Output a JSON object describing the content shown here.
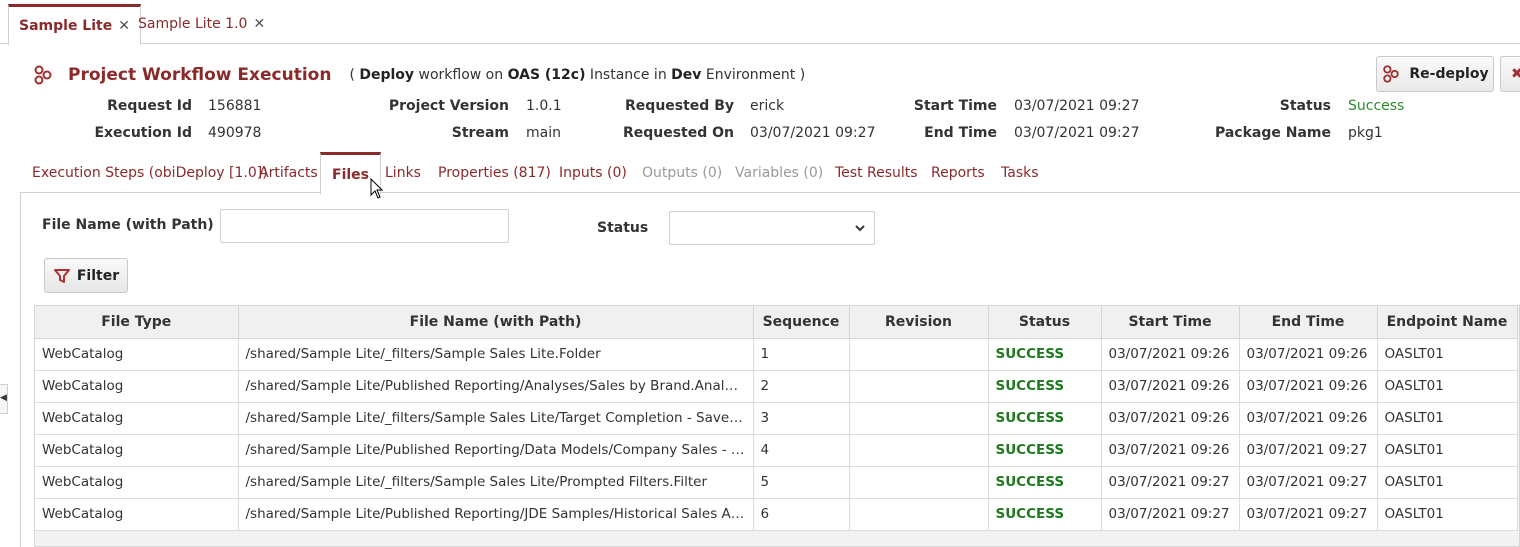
{
  "doc_tabs": [
    {
      "label": "Sample Lite",
      "active": true
    },
    {
      "label": "Sample Lite 1.0",
      "active": false
    }
  ],
  "close_glyph": "✕",
  "header": {
    "title": "Project Workflow Execution",
    "desc_open": "( ",
    "desc_workflow": "Deploy",
    "desc_on": " workflow on ",
    "desc_instance": "OAS (12c)",
    "desc_instance_in": " Instance in ",
    "desc_env": "Dev",
    "desc_close": " Environment )",
    "redeploy_label": "Re-deploy"
  },
  "meta": {
    "request_id_label": "Request Id",
    "request_id": "156881",
    "execution_id_label": "Execution Id",
    "execution_id": "490978",
    "project_version_label": "Project Version",
    "project_version": "1.0.1",
    "stream_label": "Stream",
    "stream": "main",
    "requested_by_label": "Requested By",
    "requested_by": "erick",
    "requested_on_label": "Requested On",
    "requested_on": "03/07/2021 09:27",
    "start_time_label": "Start Time",
    "start_time": "03/07/2021 09:27",
    "end_time_label": "End Time",
    "end_time": "03/07/2021 09:27",
    "status_label": "Status",
    "status": "Success",
    "package_name_label": "Package Name",
    "package_name": "pkg1"
  },
  "section_tabs": [
    {
      "label": "Execution Steps (obiDeploy [1.0])",
      "state": "normal"
    },
    {
      "label": "Artifacts",
      "state": "normal"
    },
    {
      "label": "Files",
      "state": "active"
    },
    {
      "label": "Links",
      "state": "normal"
    },
    {
      "label": "Properties (817)",
      "state": "normal"
    },
    {
      "label": "Inputs (0)",
      "state": "normal"
    },
    {
      "label": "Outputs (0)",
      "state": "disabled"
    },
    {
      "label": "Variables (0)",
      "state": "disabled"
    },
    {
      "label": "Test Results",
      "state": "normal"
    },
    {
      "label": "Reports",
      "state": "normal"
    },
    {
      "label": "Tasks",
      "state": "normal"
    }
  ],
  "filters": {
    "file_name_label": "File Name (with Path)",
    "file_name_value": "",
    "status_label": "Status",
    "status_value": "",
    "filter_button": "Filter"
  },
  "table": {
    "columns": [
      "File Type",
      "File Name (with Path)",
      "Sequence",
      "Revision",
      "Status",
      "Start Time",
      "End Time",
      "Endpoint Name"
    ],
    "rows": [
      [
        "WebCatalog",
        "/shared/Sample Lite/_filters/Sample Sales Lite.Folder",
        "1",
        "",
        "SUCCESS",
        "03/07/2021 09:26",
        "03/07/2021 09:26",
        "OASLT01"
      ],
      [
        "WebCatalog",
        "/shared/Sample Lite/Published Reporting/Analyses/Sales by Brand.Analysis",
        "2",
        "",
        "SUCCESS",
        "03/07/2021 09:26",
        "03/07/2021 09:26",
        "OASLT01"
      ],
      [
        "WebCatalog",
        "/shared/Sample Lite/_filters/Sample Sales Lite/Target Completion - Saved Column.Filter",
        "3",
        "",
        "SUCCESS",
        "03/07/2021 09:26",
        "03/07/2021 09:26",
        "OASLT01"
      ],
      [
        "WebCatalog",
        "/shared/Sample Lite/Published Reporting/Data Models/Company Sales - Currency.DataModel",
        "4",
        "",
        "SUCCESS",
        "03/07/2021 09:26",
        "03/07/2021 09:27",
        "OASLT01"
      ],
      [
        "WebCatalog",
        "/shared/Sample Lite/_filters/Sample Sales Lite/Prompted Filters.Filter",
        "5",
        "",
        "SUCCESS",
        "03/07/2021 09:27",
        "03/07/2021 09:27",
        "OASLT01"
      ],
      [
        "WebCatalog",
        "/shared/Sample Lite/Published Reporting/JDE Samples/Historical Sales Analysis.Analysis",
        "6",
        "",
        "SUCCESS",
        "03/07/2021 09:27",
        "03/07/2021 09:27",
        "OASLT01"
      ]
    ]
  },
  "colors": {
    "accent": "#8a2a2a",
    "success": "#1f7a1f"
  }
}
